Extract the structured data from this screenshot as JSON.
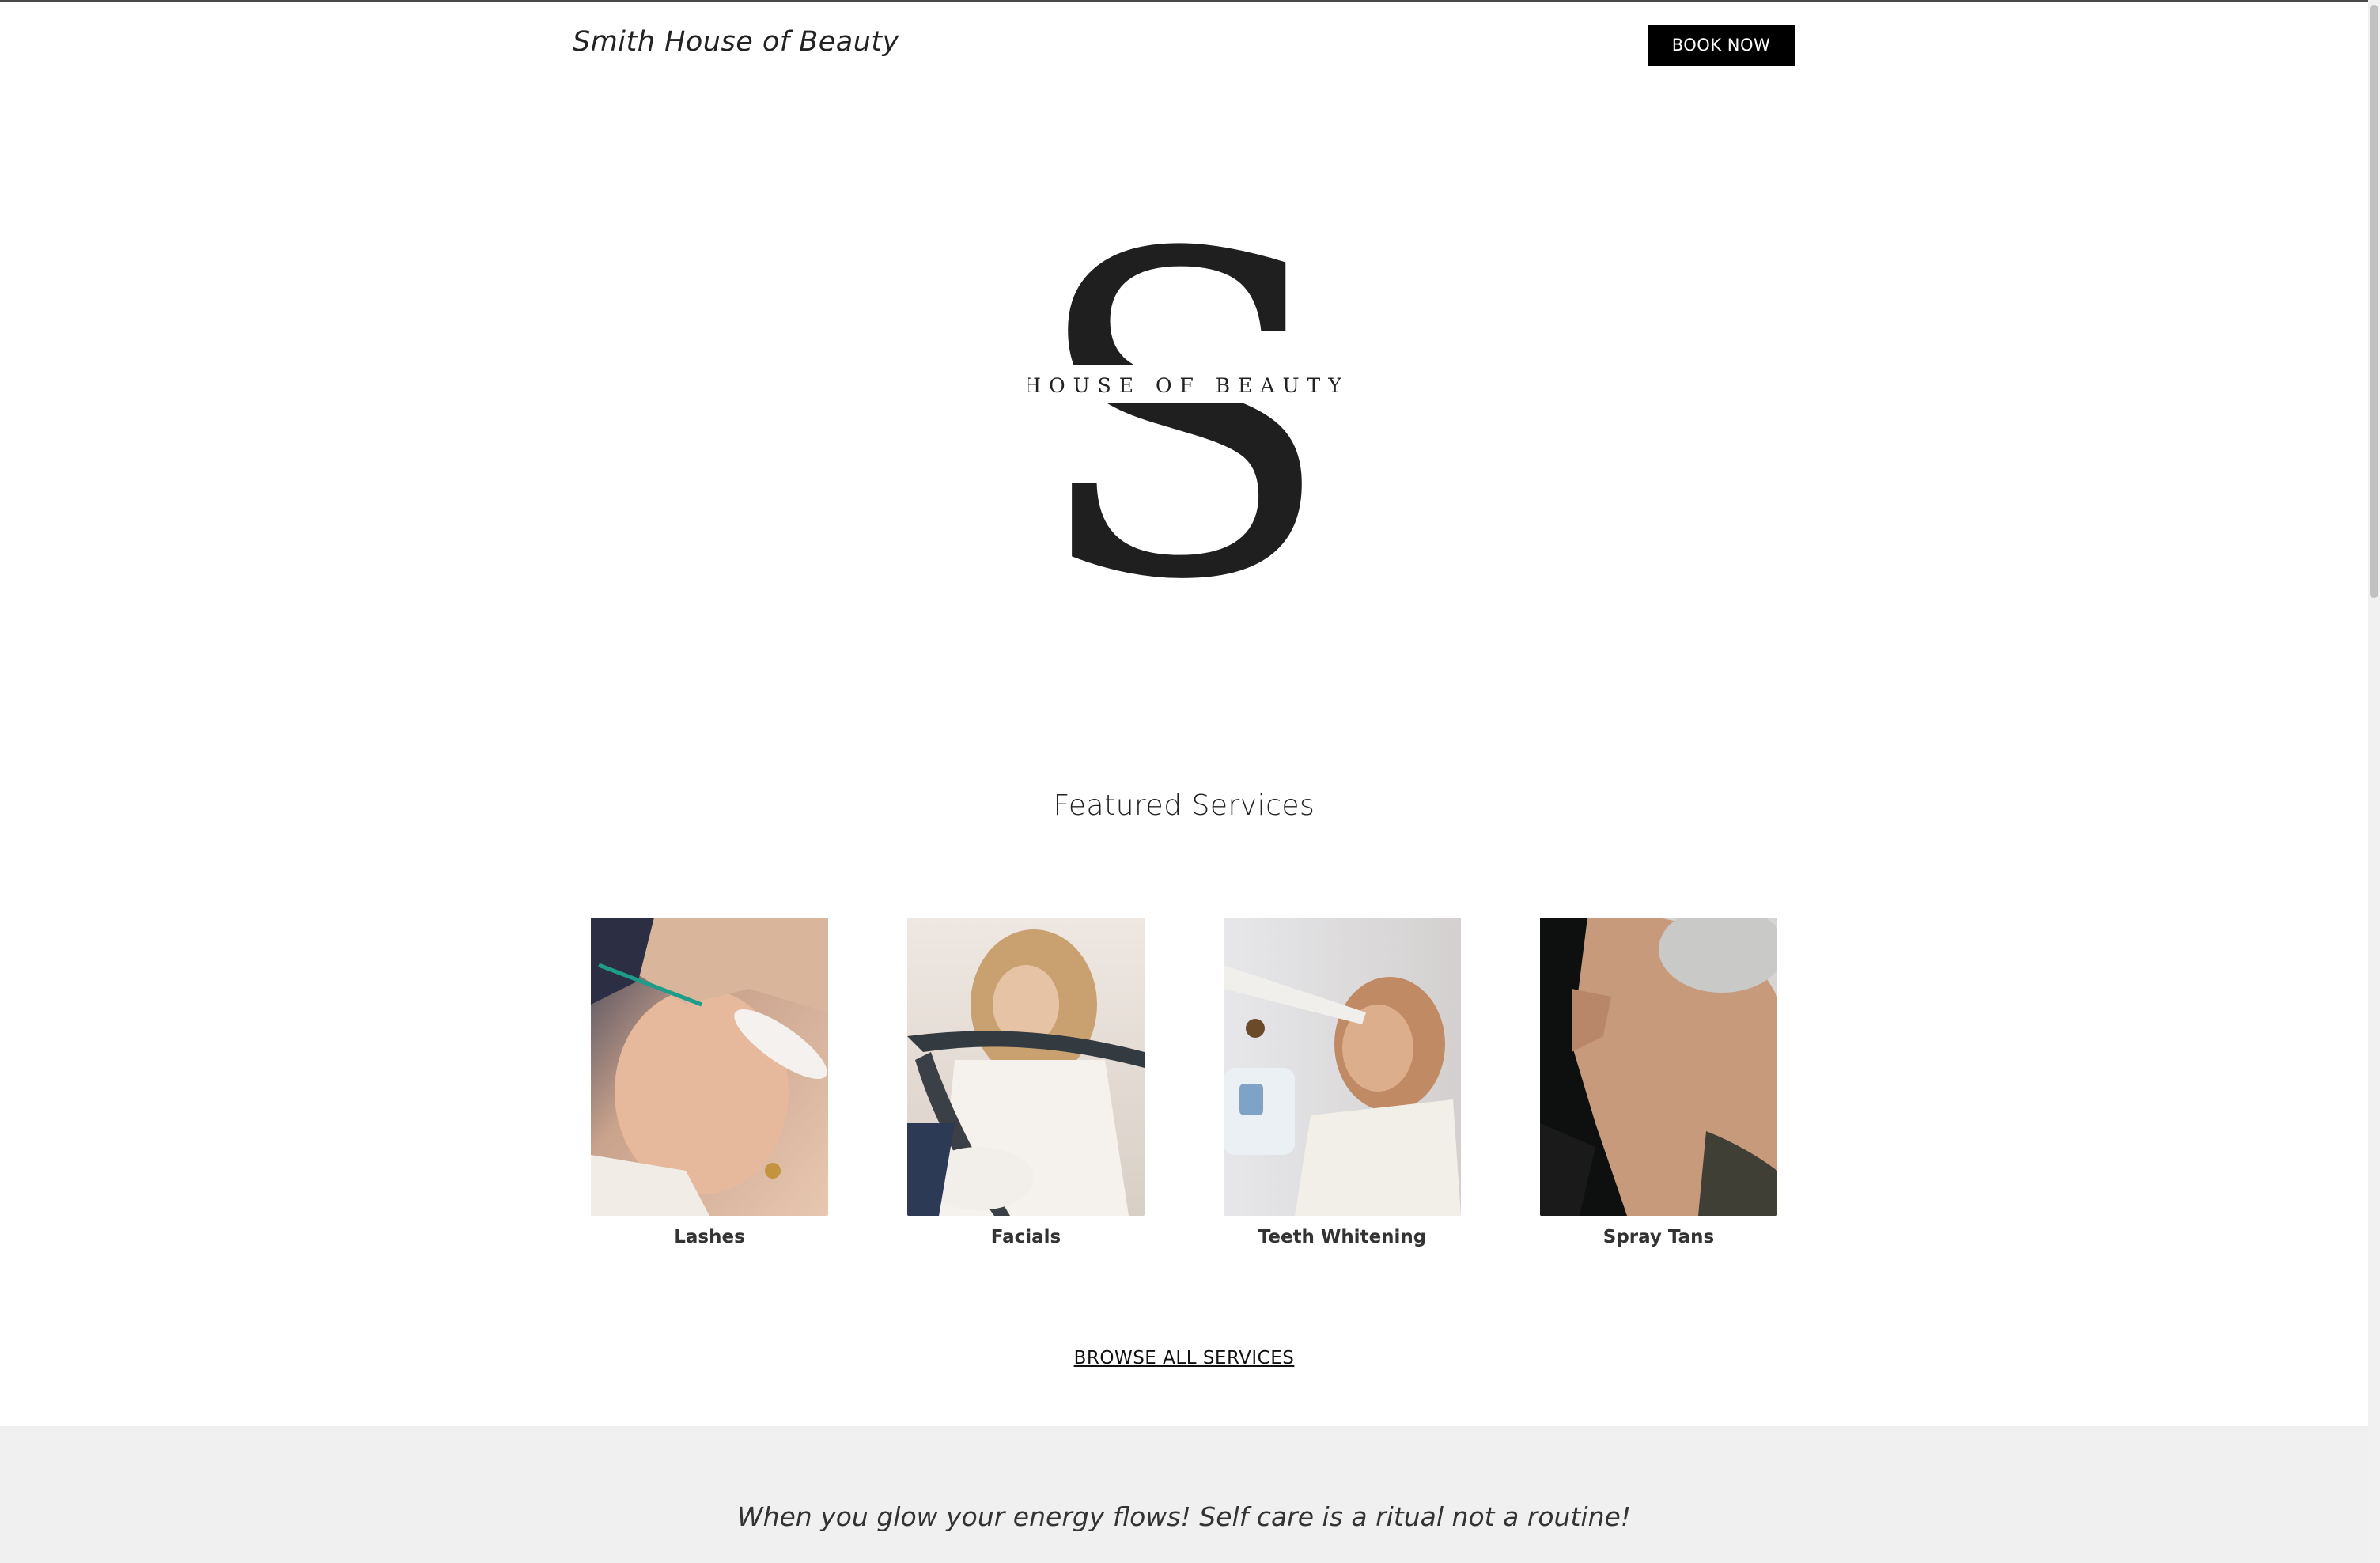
{
  "header": {
    "site_title": "Smith House of Beauty",
    "book_button_label": "BOOK NOW"
  },
  "logo": {
    "tagline": "HOUSE OF BEAUTY"
  },
  "featured": {
    "title": "Featured Services",
    "cards": [
      {
        "label": "Lashes"
      },
      {
        "label": "Facials"
      },
      {
        "label": "Teeth Whitening"
      },
      {
        "label": "Spray Tans"
      }
    ],
    "browse_link_label": "BROWSE ALL SERVICES"
  },
  "quote_band": {
    "text": "When you glow your energy flows! Self care is a ritual not a routine!"
  }
}
